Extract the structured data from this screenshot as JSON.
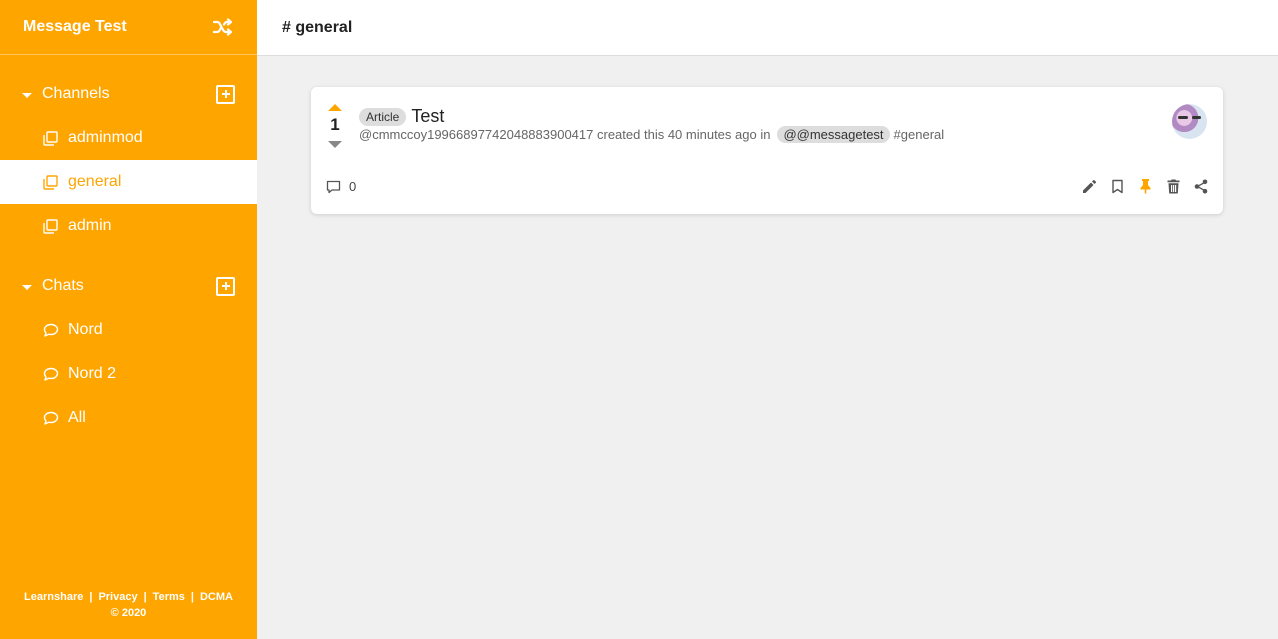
{
  "app": {
    "title": "Message Test",
    "accent": "#ffa500"
  },
  "sidebar": {
    "channels": {
      "label": "Channels",
      "items": [
        {
          "label": "adminmod",
          "active": false
        },
        {
          "label": "general",
          "active": true
        },
        {
          "label": "admin",
          "active": false
        }
      ]
    },
    "chats": {
      "label": "Chats",
      "items": [
        {
          "label": "Nord"
        },
        {
          "label": "Nord 2"
        },
        {
          "label": "All"
        }
      ]
    },
    "footer": {
      "links": [
        "Learnshare",
        "Privacy",
        "Terms",
        "DCMA"
      ],
      "copyright": "© 2020"
    }
  },
  "header": {
    "title": "# general"
  },
  "post": {
    "votes": "1",
    "badge": "Article",
    "title": "Test",
    "author": "@cmmccoy1996689774204888390041​7",
    "meta_text": "created this 40 minutes ago in",
    "community": "@@messagetest",
    "channel": "#general",
    "comments": "0"
  },
  "icons": {
    "shuffle": "shuffle-icon",
    "channel": "copy-icon",
    "chat": "speech-bubble-icon",
    "comment": "comment-icon",
    "edit": "pencil-icon",
    "save": "bookmark-icon",
    "pin": "pin-icon",
    "delete": "trash-icon",
    "share": "share-icon"
  }
}
